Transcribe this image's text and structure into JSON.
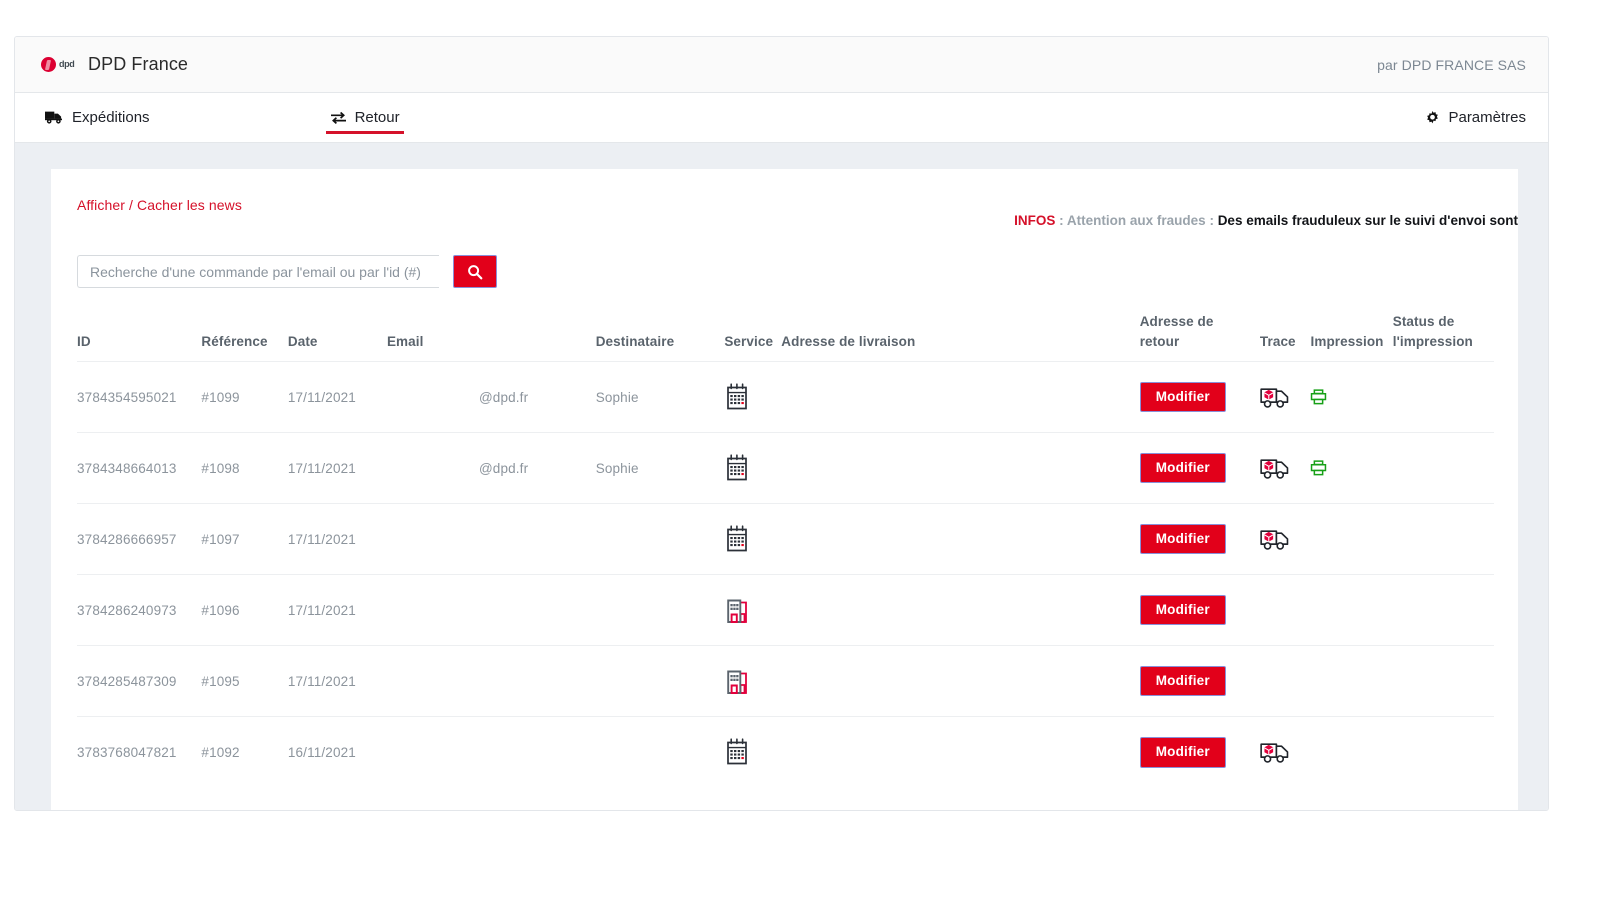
{
  "topbar": {
    "logo_alt": "dpd",
    "title": "DPD France",
    "right_text": "par DPD FRANCE SAS"
  },
  "nav": {
    "items": [
      {
        "label": "Expéditions",
        "icon": "truck-icon",
        "active": false
      },
      {
        "label": "Retour",
        "icon": "exchange-arrows-icon",
        "active": true
      }
    ],
    "settings": {
      "label": "Paramètres",
      "icon": "gear-icon"
    }
  },
  "news": {
    "toggle_label": "Afficher / Cacher les news",
    "infos_label": "INFOS",
    "infos_separator_1": " : ",
    "infos_mid": "Attention aux fraudes",
    "infos_separator_2": " : ",
    "infos_strong": "Des emails frauduleux sur le suivi d'envoi sont"
  },
  "search": {
    "value": "",
    "placeholder": "Recherche d'une commande par l'email ou par l'id (#)",
    "button_icon": "search-icon"
  },
  "table": {
    "headers": [
      "ID",
      "Référence",
      "Date",
      "Email",
      "Destinataire",
      "Service",
      "Adresse de livraison",
      "Adresse de retour",
      "Trace",
      "Impression",
      "Status de l'impression"
    ],
    "modify_label": "Modifier",
    "rows": [
      {
        "id": "3784354595021",
        "reference": "#1099",
        "date": "17/11/2021",
        "email": "@dpd.fr",
        "destinataire": "Sophie",
        "service_icon": "calendar-icon",
        "adresse_livraison": "",
        "has_modifier": true,
        "trace_icon": "delivery-truck-icon",
        "impression_icon": "printer-icon",
        "status_impression": ""
      },
      {
        "id": "3784348664013",
        "reference": "#1098",
        "date": "17/11/2021",
        "email": "@dpd.fr",
        "destinataire": "Sophie",
        "service_icon": "calendar-icon",
        "adresse_livraison": "",
        "has_modifier": true,
        "trace_icon": "delivery-truck-icon",
        "impression_icon": "printer-icon",
        "status_impression": ""
      },
      {
        "id": "3784286666957",
        "reference": "#1097",
        "date": "17/11/2021",
        "email": "",
        "destinataire": "",
        "service_icon": "calendar-icon",
        "adresse_livraison": "",
        "has_modifier": true,
        "trace_icon": "delivery-truck-icon",
        "impression_icon": "",
        "status_impression": ""
      },
      {
        "id": "3784286240973",
        "reference": "#1096",
        "date": "17/11/2021",
        "email": "",
        "destinataire": "",
        "service_icon": "relay-building-icon",
        "adresse_livraison": "",
        "has_modifier": true,
        "trace_icon": "",
        "impression_icon": "",
        "status_impression": ""
      },
      {
        "id": "3784285487309",
        "reference": "#1095",
        "date": "17/11/2021",
        "email": "",
        "destinataire": "",
        "service_icon": "relay-building-icon",
        "adresse_livraison": "",
        "has_modifier": true,
        "trace_icon": "",
        "impression_icon": "",
        "status_impression": ""
      },
      {
        "id": "3783768047821",
        "reference": "#1092",
        "date": "16/11/2021",
        "email": "",
        "destinataire": "",
        "service_icon": "calendar-icon",
        "adresse_livraison": "",
        "has_modifier": true,
        "trace_icon": "delivery-truck-icon",
        "impression_icon": "",
        "status_impression": ""
      }
    ]
  },
  "colors": {
    "brand_red": "#e2001a",
    "link_red": "#d5112a",
    "print_green": "#1f9e1f",
    "page_bg": "#eceff3",
    "button_border": "#8a8fd8"
  }
}
